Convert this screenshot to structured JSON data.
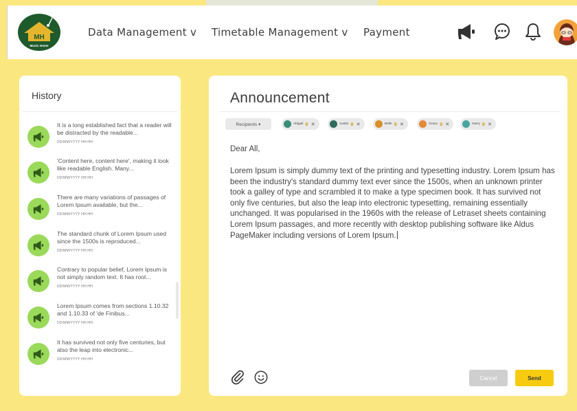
{
  "logo": {
    "initials": "MH",
    "subtitle": "Music Home"
  },
  "nav": [
    {
      "label": "Data Management v"
    },
    {
      "label": "Timetable Management v"
    },
    {
      "label": "Payment"
    }
  ],
  "header_icons": [
    "megaphone-icon",
    "chat-icon",
    "bell-icon",
    "avatar"
  ],
  "history": {
    "title": "History",
    "items": [
      {
        "text": "It is a long established fact that a reader will be distracted by the readable...",
        "date": "DD/MM/YYYY HH:HH"
      },
      {
        "text": "'Content here, content here', making it look like readable English. Many...",
        "date": "DD/MM/YYYY HH:HH"
      },
      {
        "text": "There are many variations of passages of Lorem Ipsum available, but the...",
        "date": "DD/MM/YYYY HH:HH"
      },
      {
        "text": "The standard chunk of Lorem Ipsum used since the 1500s is reproduced...",
        "date": "DD/MM/YYYY HH:HH"
      },
      {
        "text": "Contrary to popular belief, Lorem Ipsum is not simply random text. It has root...",
        "date": "DD/MM/YYYY HH:HH"
      },
      {
        "text": "Lorem Ipsum comes from sections 1.10.32 and 1.10.33 of 'de Finibus...",
        "date": "DD/MM/YYYY HH:HH"
      },
      {
        "text": "It has survived not only five centuries, but also the leap into electronic...",
        "date": "DD/MM/YYYY HH:HH"
      }
    ]
  },
  "announcement": {
    "title": "Announcement",
    "recipients_label": "Recipients ▾",
    "recipients": [
      {
        "name": "Abigail",
        "color": "#3a8c7a"
      },
      {
        "name": "Austin",
        "color": "#2f6b5a"
      },
      {
        "name": "Belle",
        "color": "#d9902b"
      },
      {
        "name": "Grace",
        "color": "#e4893a"
      },
      {
        "name": "Harry",
        "color": "#4aa3a0"
      }
    ],
    "greeting": "Dear All,",
    "body": "Lorem Ipsum is simply dummy text of the printing and typesetting industry. Lorem Ipsum has been the industry's standard dummy text ever since the 1500s, when an unknown printer took a galley of type and scrambled it to make a type specimen book. It has survived not only five centuries, but also the leap into electronic typesetting, remaining essentially unchanged. It was popularised in the 1960s with the release of Letraset sheets containing Lorem Ipsum passages, and more recently with desktop publishing software like Aldus PageMaker including versions of Lorem Ipsum.",
    "cancel_label": "Cancel",
    "send_label": "Send"
  },
  "colors": {
    "background": "#fbe77f",
    "accent": "#f7cc10",
    "history_icon": "#9ad95a",
    "logo_green": "#1e5a2c",
    "logo_roof": "#e5b62d"
  }
}
